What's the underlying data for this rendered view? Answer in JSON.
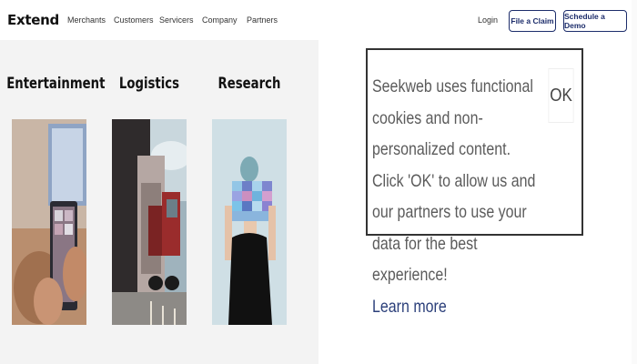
{
  "header": {
    "logo": "Extend",
    "nav": [
      "Merchants",
      "Customers",
      "Servicers",
      "Company",
      "Partners"
    ],
    "login": "Login",
    "file_claim": "File a Claim",
    "schedule_demo": "Schedule a Demo"
  },
  "categories": [
    {
      "title": "Entertainment"
    },
    {
      "title": "Logistics"
    },
    {
      "title": "Research"
    }
  ],
  "cookie": {
    "message": "Seekweb uses functional cookies and non-personalized content. Click 'OK' to allow us and our partners to use your data for the best experience!",
    "learn_more": "Learn more",
    "ok": "OK"
  },
  "colors": {
    "brand_navy": "#1d2d6b",
    "panel_bg": "#f3f3f3",
    "cookie_text": "#5b5b5b"
  }
}
